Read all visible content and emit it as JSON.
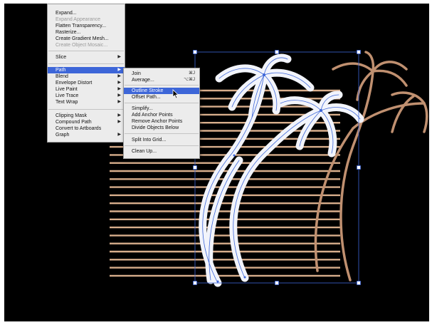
{
  "colors": {
    "canvas": "#000000",
    "stripes": "#d8ae8c",
    "palm_outline_fill": "#f2f4fb",
    "selection_blue": "#3d66d8",
    "palm_brown": "#c09070",
    "menu_bg": "#ececec"
  },
  "object_menu": {
    "items": [
      {
        "label": "Expand...",
        "disabled": false
      },
      {
        "label": "Expand Appearance",
        "disabled": true
      },
      {
        "label": "Flatten Transparency...",
        "disabled": false
      },
      {
        "label": "Rasterize...",
        "disabled": false
      },
      {
        "label": "Create Gradient Mesh...",
        "disabled": false
      },
      {
        "label": "Create Object Mosaic...",
        "disabled": true
      },
      {
        "label": "Slice",
        "disabled": false,
        "submenu": true
      },
      {
        "label": "Path",
        "disabled": false,
        "submenu": true,
        "highlighted": true
      },
      {
        "label": "Blend",
        "disabled": false,
        "submenu": true
      },
      {
        "label": "Envelope Distort",
        "disabled": false,
        "submenu": true
      },
      {
        "label": "Live Paint",
        "disabled": false,
        "submenu": true
      },
      {
        "label": "Live Trace",
        "disabled": false,
        "submenu": true
      },
      {
        "label": "Text Wrap",
        "disabled": false,
        "submenu": true
      },
      {
        "label": "Clipping Mask",
        "disabled": false,
        "submenu": true
      },
      {
        "label": "Compound Path",
        "disabled": false,
        "submenu": true
      },
      {
        "label": "Convert to Artboards",
        "disabled": false
      },
      {
        "label": "Graph",
        "disabled": false,
        "submenu": true
      }
    ]
  },
  "path_submenu": {
    "items": [
      {
        "label": "Join",
        "shortcut": "⌘J"
      },
      {
        "label": "Average...",
        "shortcut": "⌥⌘J"
      },
      {
        "label": "Outline Stroke",
        "highlighted": true
      },
      {
        "label": "Offset Path..."
      },
      {
        "label": "Simplify..."
      },
      {
        "label": "Add Anchor Points"
      },
      {
        "label": "Remove Anchor Points"
      },
      {
        "label": "Divide Objects Below"
      },
      {
        "label": "Split Into Grid..."
      },
      {
        "label": "Clean Up..."
      }
    ]
  },
  "icons": {
    "submenu_arrow": "▶",
    "cursor": "arrow-pointer"
  }
}
